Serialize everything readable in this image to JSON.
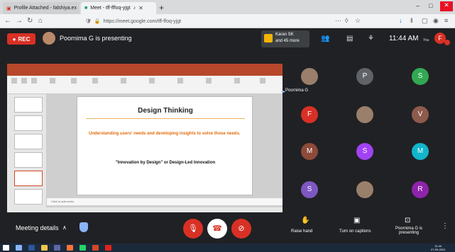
{
  "browser": {
    "tabs": [
      {
        "label": "Profile Attached - falshiya.ex",
        "active": false
      },
      {
        "label": "Meet - tff-fffoq-yjgt",
        "active": true
      }
    ],
    "new_tab": "+",
    "url": "https://meet.google.com/tff-ffoq-yjgt"
  },
  "meet": {
    "rec_label": "REC",
    "presenting_text": "Poornima G is presenting",
    "join_name": "Karan SK",
    "join_more": "and 45 more",
    "clock": "11:44 AM",
    "you_label": "You",
    "self_initial": "F"
  },
  "slide": {
    "title": "Design Thinking",
    "subtitle": "Understanding users' needs and developing insights to solve those needs.",
    "quote": "\"Innovation by Design\" or Design-Led Innovation",
    "notes_placeholder": "Click to add notes"
  },
  "participants": {
    "presenter_name": "Poornima G",
    "tiles": [
      {
        "initial": "",
        "color": "#3c4043",
        "kind": "photo"
      },
      {
        "initial": "P",
        "color": "#5f6368"
      },
      {
        "initial": "S",
        "color": "#33a853"
      },
      {
        "initial": "F",
        "color": "#d93025"
      },
      {
        "initial": "",
        "color": "#3c4043",
        "kind": "photo"
      },
      {
        "initial": "V",
        "color": "#8d5b4c"
      },
      {
        "initial": "M",
        "color": "#8d4a3a"
      },
      {
        "initial": "S",
        "color": "#a142f4"
      },
      {
        "initial": "M",
        "color": "#12b5cb"
      },
      {
        "initial": "S",
        "color": "#7e57c2"
      },
      {
        "initial": "",
        "color": "#3c4043",
        "kind": "photo"
      },
      {
        "initial": "R",
        "color": "#8e24aa"
      }
    ]
  },
  "controls": {
    "meeting_details": "Meeting details",
    "raise_hand": "Raise hand",
    "captions": "Turn on captions",
    "presenting_label": "Poornima G is presenting",
    "more": "⋮"
  },
  "taskbar": {
    "time": "11:44",
    "date": "27-09-2021"
  }
}
